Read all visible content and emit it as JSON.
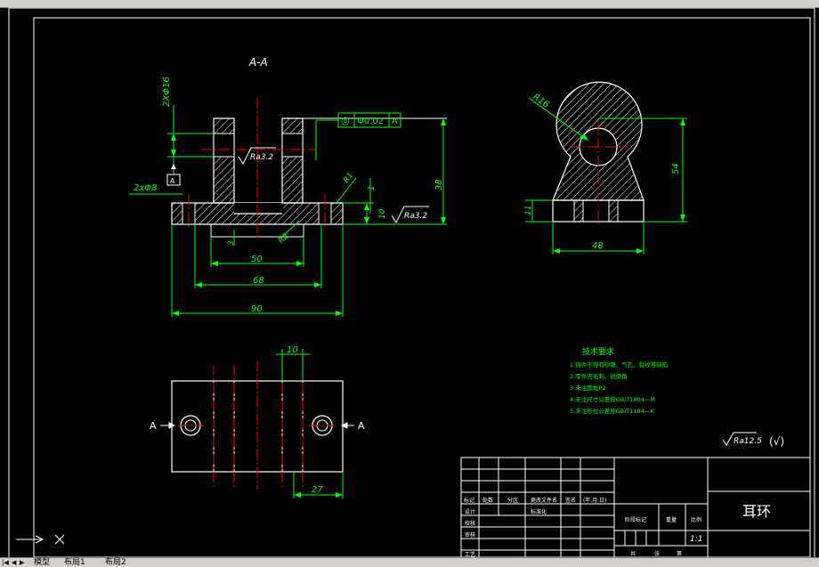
{
  "app": {
    "window_title": ""
  },
  "tabs": {
    "items": [
      {
        "label": "模型"
      },
      {
        "label": "布局1"
      },
      {
        "label": "布局2"
      }
    ]
  },
  "drawing": {
    "section_label": "A-A",
    "dims": {
      "hole_spec_vert": "2XΦ16",
      "hole_spec_left": "2xΦ8",
      "tolerance_symbol": "◎",
      "tolerance_value": "Φ0.02",
      "tolerance_datum": "A",
      "datum_box": "A",
      "ra_top": "Ra3.2",
      "ra_right": "Ra3.2",
      "dim_38": "38",
      "dim_10": "10",
      "dim_1": "1",
      "dim_3": "3",
      "dim_R1": "R1",
      "dim_R2": "R2",
      "dim_50": "50",
      "dim_68": "68",
      "dim_90": "90",
      "dim_R16": "R16",
      "dim_54": "54",
      "dim_11": "11",
      "dim_48": "48",
      "dim_10b": "10",
      "dim_27": "27",
      "section_A_left": "A",
      "section_A_right": "A",
      "ra_global": "Ra12.5",
      "ra_global_paren": "(√)"
    },
    "tech_notes": {
      "title": "技术要求",
      "lines": [
        "1.铸件不得有砂眼、气孔、裂纹等缺陷",
        "2.零件去毛刺、锐倒角",
        "3.未注圆角R2",
        "4.未注尺寸公差按GB/T1804—M",
        "5.未注形位公差按GB/T1184—K"
      ]
    },
    "title_block": {
      "part_name": "耳环",
      "row_labels": [
        "标记",
        "处数",
        "分区",
        "更改文件名",
        "签名",
        "(年.月.日)"
      ],
      "left_labels": [
        "设计",
        "校核",
        "审核",
        "工艺"
      ],
      "std_label": "标准化",
      "stage_label": "阶段标记",
      "weight_label": "重量",
      "scale_label": "比例",
      "scale_value": "1:1",
      "sheet_left": "共",
      "sheet_mid": "张",
      "sheet_right": "第"
    }
  },
  "colors": {
    "background": "#000000",
    "outline": "#ffffff",
    "dimension": "#00ff00",
    "centerline": "#ff0000",
    "tech_text": "#00ff00",
    "hatch": "#ffffff",
    "tolerance_frame": "#00ff00"
  }
}
